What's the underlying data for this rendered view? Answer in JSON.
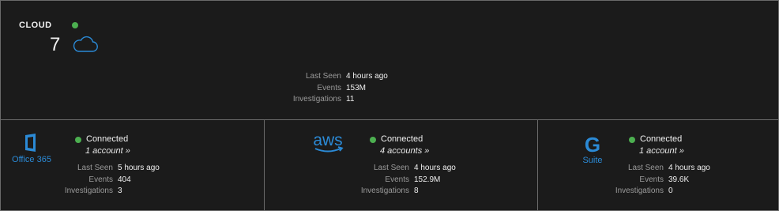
{
  "cloud": {
    "title": "CLOUD",
    "count": "7",
    "status_color": "#4caf50",
    "icon": "cloud-icon",
    "stats": [
      {
        "label": "Last Seen",
        "value": "4 hours ago"
      },
      {
        "label": "Events",
        "value": "153M"
      },
      {
        "label": "Investigations",
        "value": "11"
      }
    ]
  },
  "providers": [
    {
      "logo_text": "Office 365",
      "icon": "office365-logo",
      "status": "Connected",
      "accounts": "1 account »",
      "stats": [
        {
          "label": "Last Seen",
          "value": "5 hours ago"
        },
        {
          "label": "Events",
          "value": "404"
        },
        {
          "label": "Investigations",
          "value": "3"
        }
      ]
    },
    {
      "logo_text": "aws",
      "icon": "aws-logo",
      "status": "Connected",
      "accounts": "4 accounts »",
      "stats": [
        {
          "label": "Last Seen",
          "value": "4 hours ago"
        },
        {
          "label": "Events",
          "value": "152.9M"
        },
        {
          "label": "Investigations",
          "value": "8"
        }
      ]
    },
    {
      "logo_text": "G",
      "logo_subtext": "Suite",
      "icon": "gsuite-logo",
      "status": "Connected",
      "accounts": "1 account »",
      "stats": [
        {
          "label": "Last Seen",
          "value": "4 hours ago"
        },
        {
          "label": "Events",
          "value": "39.6K"
        },
        {
          "label": "Investigations",
          "value": "0"
        }
      ]
    }
  ],
  "colors": {
    "accent_blue": "#2b8ad6",
    "status_green": "#4caf50",
    "background": "#1b1b1b",
    "border": "#6a6a6a"
  }
}
